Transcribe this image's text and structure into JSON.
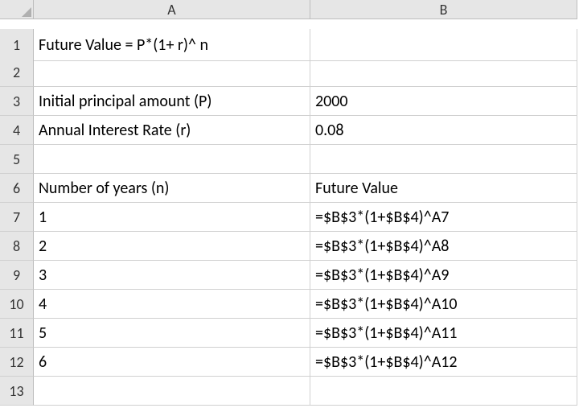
{
  "columns": {
    "A": "A",
    "B": "B"
  },
  "rows": {
    "r1": "1",
    "r2": "2",
    "r3": "3",
    "r4": "4",
    "r5": "5",
    "r6": "6",
    "r7": "7",
    "r8": "8",
    "r9": "9",
    "r10": "10",
    "r11": "11",
    "r12": "12",
    "r13": "13"
  },
  "cells": {
    "A1": "Future Value = P*(1+ r)^ n",
    "A2": "",
    "A3": "Initial principal amount (P)",
    "A4": "Annual Interest Rate (r)",
    "A5": "",
    "A6": "Number of years (n)",
    "A7": "1",
    "A8": "2",
    "A9": "3",
    "A10": "4",
    "A11": "5",
    "A12": "6",
    "A13": "",
    "B1": "",
    "B2": "",
    "B3": "2000",
    "B4": "0.08",
    "B5": "",
    "B6": "Future Value",
    "B7": "=$B$3*(1+$B$4)^A7",
    "B8": "=$B$3*(1+$B$4)^A8",
    "B9": "=$B$3*(1+$B$4)^A9",
    "B10": "=$B$3*(1+$B$4)^A10",
    "B11": "=$B$3*(1+$B$4)^A11",
    "B12": "=$B$3*(1+$B$4)^A12",
    "B13": ""
  },
  "chart_data": {
    "type": "table",
    "title": "Future Value = P*(1+ r)^ n",
    "parameters": {
      "P": 2000,
      "r": 0.08
    },
    "columns": [
      "Number of years (n)",
      "Future Value"
    ],
    "rows": [
      [
        1,
        "=$B$3*(1+$B$4)^A7"
      ],
      [
        2,
        "=$B$3*(1+$B$4)^A8"
      ],
      [
        3,
        "=$B$3*(1+$B$4)^A9"
      ],
      [
        4,
        "=$B$3*(1+$B$4)^A10"
      ],
      [
        5,
        "=$B$3*(1+$B$4)^A11"
      ],
      [
        6,
        "=$B$3*(1+$B$4)^A12"
      ]
    ]
  }
}
